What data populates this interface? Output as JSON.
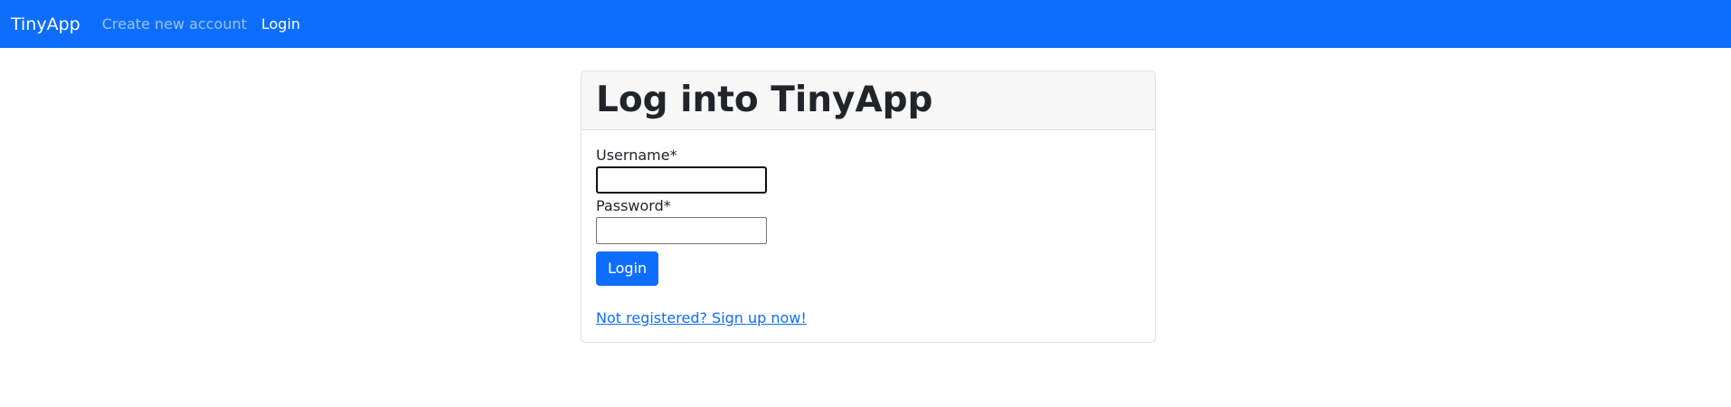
{
  "navbar": {
    "brand": "TinyApp",
    "links": [
      {
        "label": "Create new account",
        "active": false
      },
      {
        "label": "Login",
        "active": true
      }
    ]
  },
  "login_card": {
    "title": "Log into TinyApp",
    "username_label": "Username",
    "password_label": "Password",
    "required_marker": "*",
    "username_value": "",
    "password_value": "",
    "submit_label": "Login",
    "signup_link": "Not registered? Sign up now!"
  },
  "colors": {
    "primary": "#0d6efd",
    "header_bg": "#f7f7f7",
    "border": "#dee2e6"
  }
}
